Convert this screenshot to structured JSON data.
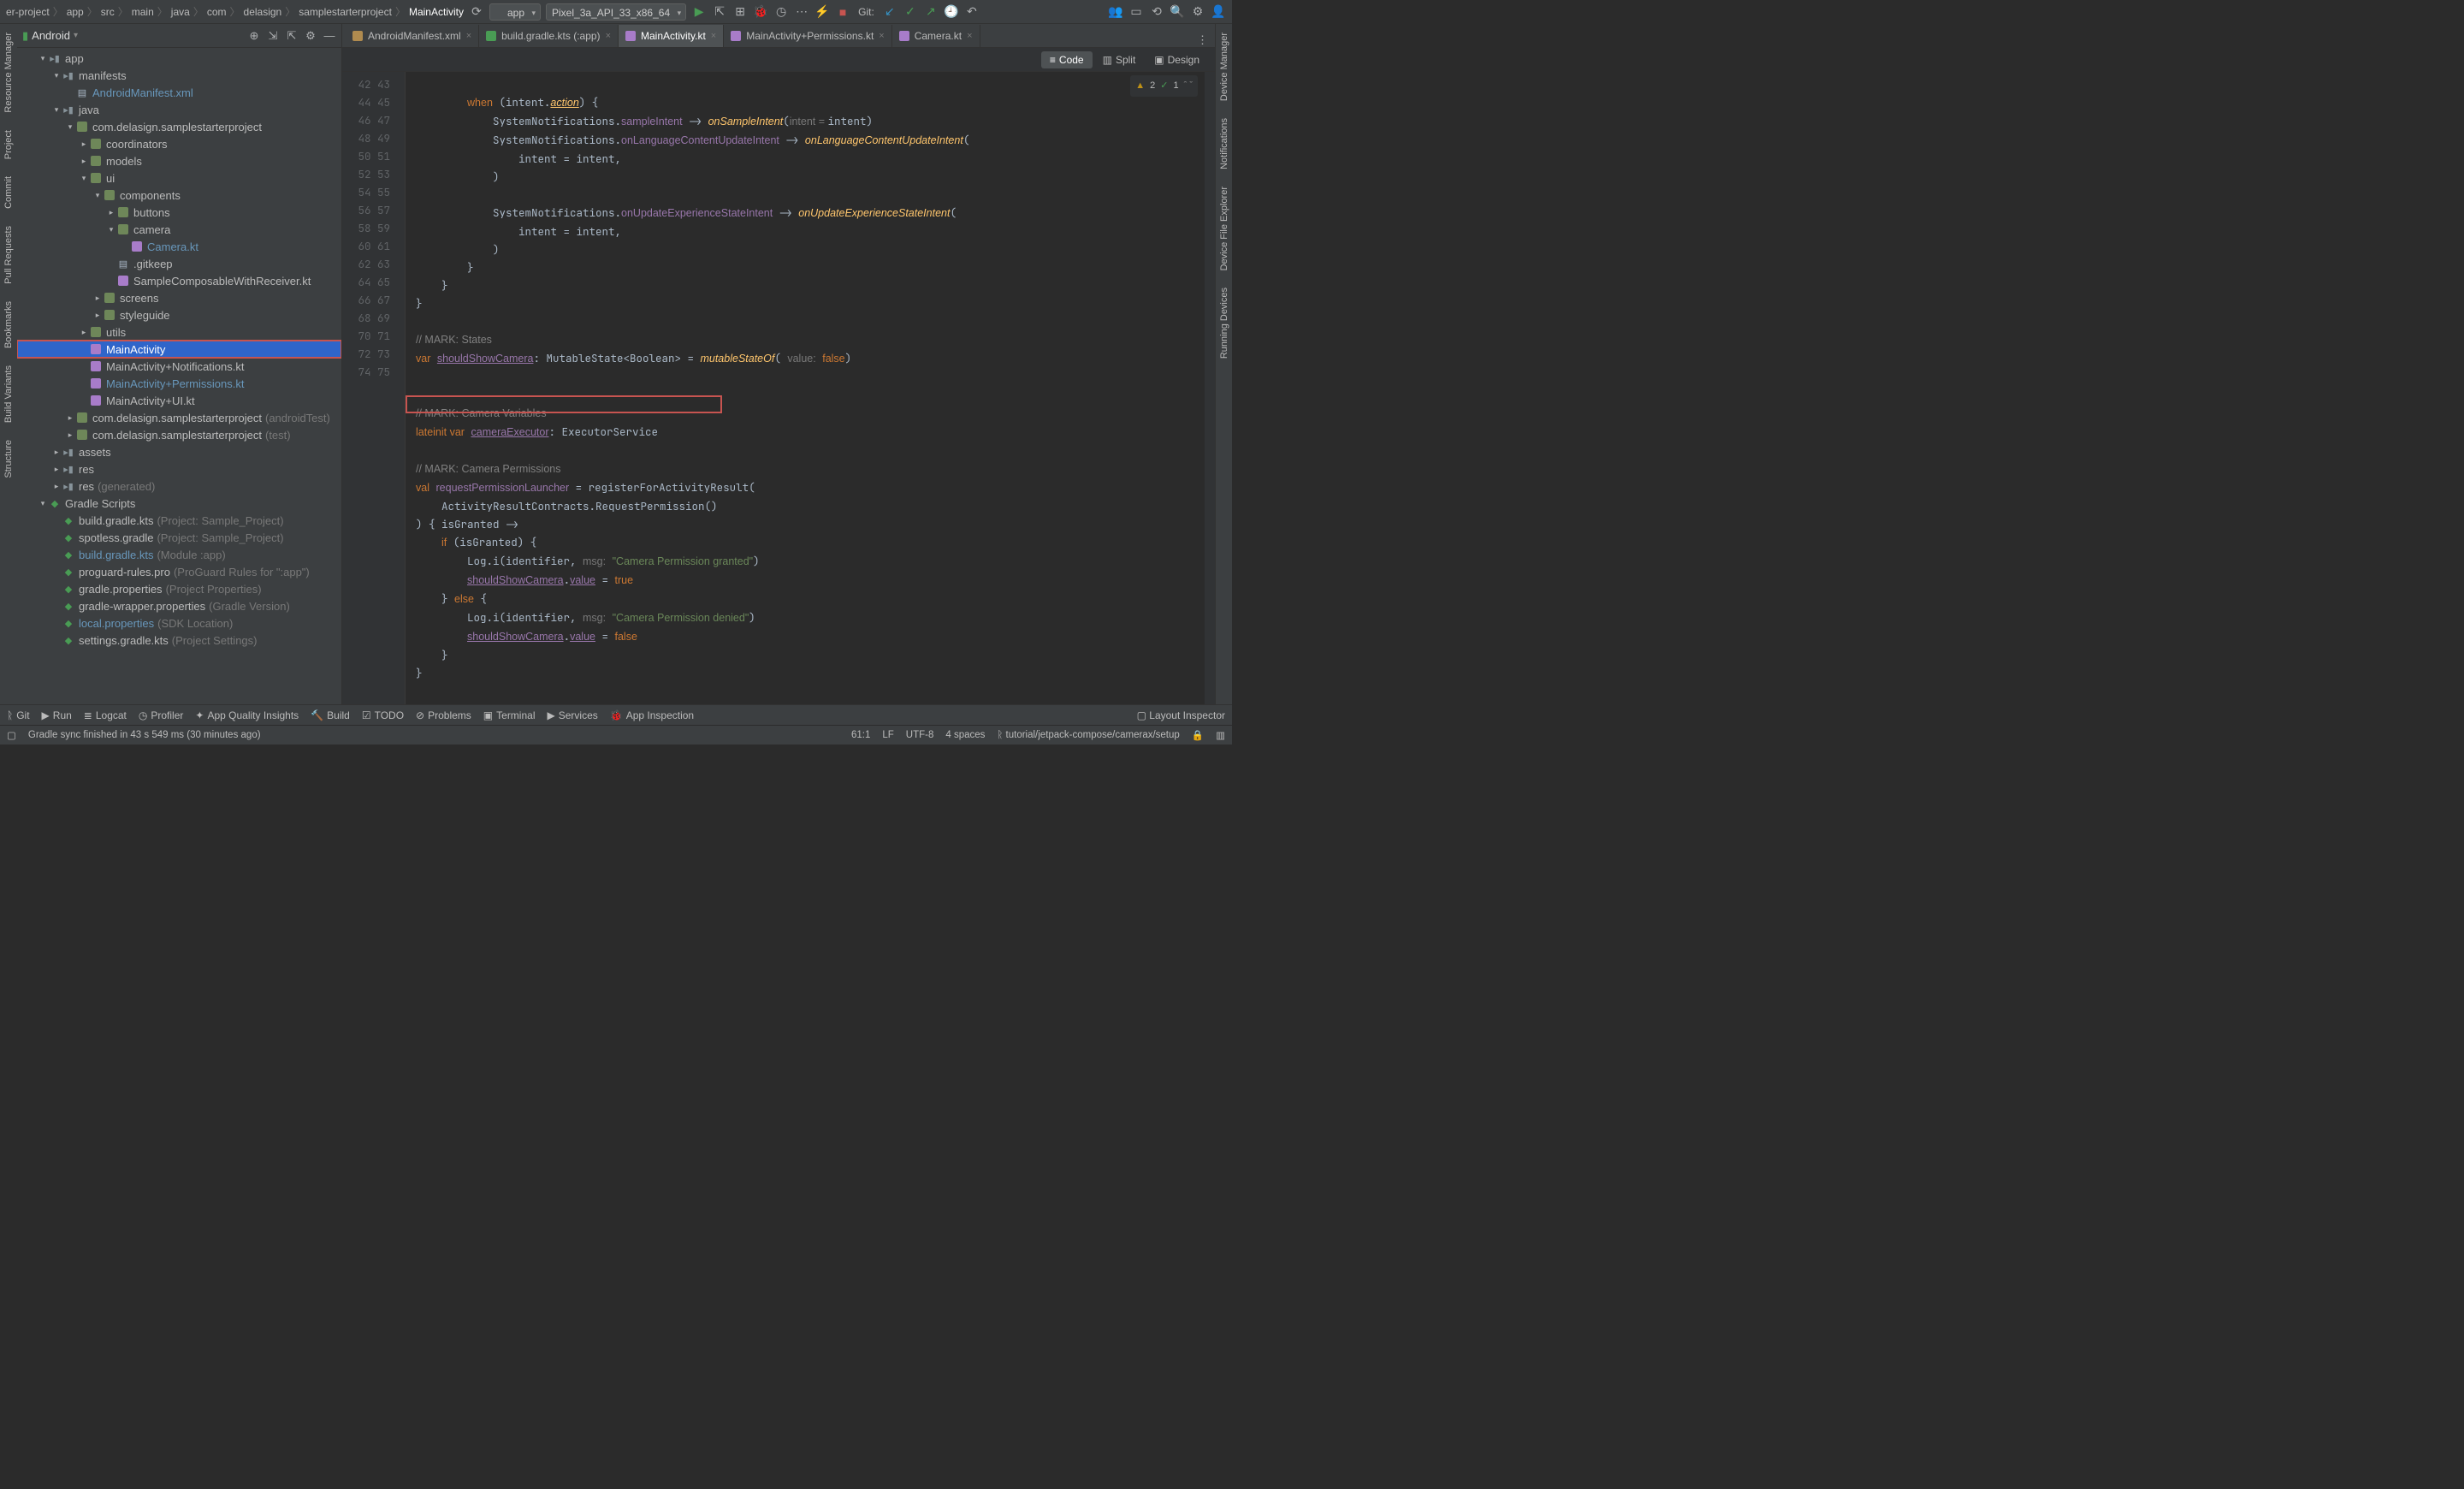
{
  "breadcrumbs": [
    "er-project",
    "app",
    "src",
    "main",
    "java",
    "com",
    "delasign",
    "samplestarterproject",
    "MainActivity"
  ],
  "run_config": "app",
  "device": "Pixel_3a_API_33_x86_64",
  "git_label": "Git:",
  "project_panel": {
    "title": "Android"
  },
  "left_tabs": [
    "Resource Manager",
    "Project",
    "Commit",
    "Pull Requests",
    "Bookmarks",
    "Build Variants",
    "Structure"
  ],
  "right_tabs": [
    "Device Manager",
    "Notifications",
    "Device File Explorer",
    "Running Devices"
  ],
  "tree": [
    {
      "d": 1,
      "tw": "▾",
      "ic": "mod",
      "lbl": "app"
    },
    {
      "d": 2,
      "tw": "▾",
      "ic": "fld",
      "lbl": "manifests"
    },
    {
      "d": 3,
      "tw": "",
      "ic": "xml",
      "lbl": "AndroidManifest.xml",
      "mod": true
    },
    {
      "d": 2,
      "tw": "▾",
      "ic": "fld",
      "lbl": "java"
    },
    {
      "d": 3,
      "tw": "▾",
      "ic": "pkg",
      "lbl": "com.delasign.samplestarterproject"
    },
    {
      "d": 4,
      "tw": "▸",
      "ic": "pkg",
      "lbl": "coordinators"
    },
    {
      "d": 4,
      "tw": "▸",
      "ic": "pkg",
      "lbl": "models"
    },
    {
      "d": 4,
      "tw": "▾",
      "ic": "pkg",
      "lbl": "ui"
    },
    {
      "d": 5,
      "tw": "▾",
      "ic": "pkg",
      "lbl": "components"
    },
    {
      "d": 6,
      "tw": "▸",
      "ic": "pkg",
      "lbl": "buttons"
    },
    {
      "d": 6,
      "tw": "▾",
      "ic": "pkg",
      "lbl": "camera"
    },
    {
      "d": 7,
      "tw": "",
      "ic": "kt",
      "lbl": "Camera.kt",
      "mod": true
    },
    {
      "d": 6,
      "tw": "",
      "ic": "txt",
      "lbl": ".gitkeep"
    },
    {
      "d": 6,
      "tw": "",
      "ic": "kt",
      "lbl": "SampleComposableWithReceiver.kt"
    },
    {
      "d": 5,
      "tw": "▸",
      "ic": "pkg",
      "lbl": "screens"
    },
    {
      "d": 5,
      "tw": "▸",
      "ic": "pkg",
      "lbl": "styleguide"
    },
    {
      "d": 4,
      "tw": "▸",
      "ic": "pkg",
      "lbl": "utils"
    },
    {
      "d": 4,
      "tw": "",
      "ic": "kt",
      "lbl": "MainActivity",
      "sel": true,
      "boxed": true
    },
    {
      "d": 4,
      "tw": "",
      "ic": "kt",
      "lbl": "MainActivity+Notifications.kt"
    },
    {
      "d": 4,
      "tw": "",
      "ic": "kt",
      "lbl": "MainActivity+Permissions.kt",
      "mod": true
    },
    {
      "d": 4,
      "tw": "",
      "ic": "kt",
      "lbl": "MainActivity+UI.kt"
    },
    {
      "d": 3,
      "tw": "▸",
      "ic": "pkg",
      "lbl": "com.delasign.samplestarterproject",
      "hint": "(androidTest)"
    },
    {
      "d": 3,
      "tw": "▸",
      "ic": "pkg",
      "lbl": "com.delasign.samplestarterproject",
      "hint": "(test)"
    },
    {
      "d": 2,
      "tw": "▸",
      "ic": "fld",
      "lbl": "assets"
    },
    {
      "d": 2,
      "tw": "▸",
      "ic": "fld",
      "lbl": "res"
    },
    {
      "d": 2,
      "tw": "▸",
      "ic": "fld",
      "lbl": "res",
      "hint": "(generated)"
    },
    {
      "d": 1,
      "tw": "▾",
      "ic": "grd",
      "lbl": "Gradle Scripts"
    },
    {
      "d": 2,
      "tw": "",
      "ic": "grd",
      "lbl": "build.gradle.kts",
      "hint": "(Project: Sample_Project)"
    },
    {
      "d": 2,
      "tw": "",
      "ic": "grd",
      "lbl": "spotless.gradle",
      "hint": "(Project: Sample_Project)"
    },
    {
      "d": 2,
      "tw": "",
      "ic": "grd",
      "lbl": "build.gradle.kts",
      "hint": "(Module :app)",
      "mod": true
    },
    {
      "d": 2,
      "tw": "",
      "ic": "grd",
      "lbl": "proguard-rules.pro",
      "hint": "(ProGuard Rules for \":app\")"
    },
    {
      "d": 2,
      "tw": "",
      "ic": "grd",
      "lbl": "gradle.properties",
      "hint": "(Project Properties)"
    },
    {
      "d": 2,
      "tw": "",
      "ic": "grd",
      "lbl": "gradle-wrapper.properties",
      "hint": "(Gradle Version)"
    },
    {
      "d": 2,
      "tw": "",
      "ic": "grd",
      "lbl": "local.properties",
      "hint": "(SDK Location)",
      "mod": true
    },
    {
      "d": 2,
      "tw": "",
      "ic": "grd",
      "lbl": "settings.gradle.kts",
      "hint": "(Project Settings)"
    }
  ],
  "editor_tabs": [
    {
      "label": "AndroidManifest.xml",
      "ic": "xml"
    },
    {
      "label": "build.gradle.kts (:app)",
      "ic": "grd"
    },
    {
      "label": "MainActivity.kt",
      "ic": "kt",
      "active": true
    },
    {
      "label": "MainActivity+Permissions.kt",
      "ic": "kt"
    },
    {
      "label": "Camera.kt",
      "ic": "kt"
    }
  ],
  "view_modes": {
    "code": "Code",
    "split": "Split",
    "design": "Design"
  },
  "inspection": {
    "warn": "2",
    "ok": "1"
  },
  "gutter_start": 42,
  "gutter_end": 75,
  "bottom_tools": [
    "Git",
    "Run",
    "Logcat",
    "Profiler",
    "App Quality Insights",
    "Build",
    "TODO",
    "Problems",
    "Terminal",
    "Services",
    "App Inspection"
  ],
  "layout_inspector": "Layout Inspector",
  "status": {
    "msg": "Gradle sync finished in 43 s 549 ms (30 minutes ago)",
    "pos": "61:1",
    "sep": "LF",
    "enc": "UTF-8",
    "indent": "4 spaces",
    "branch": "tutorial/jetpack-compose/camerax/setup"
  }
}
